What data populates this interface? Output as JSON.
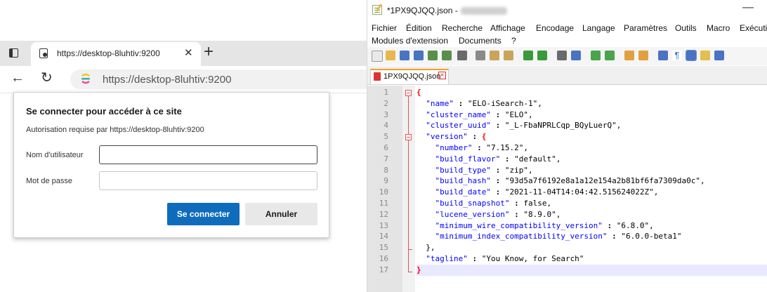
{
  "browser": {
    "tab_title": "https://desktop-8luhtiv:9200",
    "tab_close": "✕",
    "new_tab": "+",
    "url": "https://desktop-8luhtiv:9200",
    "dialog": {
      "title": "Se connecter pour accéder à ce site",
      "subtitle": "Autorisation requise par https://desktop-8luhtiv:9200",
      "username_label": "Nom d'utilisateur",
      "username_value": "",
      "password_label": "Mot de passe",
      "password_value": "",
      "signin_label": "Se connecter",
      "cancel_label": "Annuler"
    }
  },
  "npp": {
    "window_title": "*1PX9QJQQ.json -",
    "minimize": "—",
    "menu": [
      {
        "label": "Fichier"
      },
      {
        "label": "Édition"
      },
      {
        "label": "Recherche"
      },
      {
        "label": "Affichage"
      },
      {
        "label": "Encodage"
      },
      {
        "label": "Langage"
      },
      {
        "label": "Paramètres"
      },
      {
        "label": "Outils"
      },
      {
        "label": "Macro"
      },
      {
        "label": "Exécuti"
      },
      {
        "label": "Modules d'extension"
      },
      {
        "label": "Documents"
      },
      {
        "label": "?"
      }
    ],
    "file_tab": "1PX9QJQQ.json",
    "file_tab_close": "×",
    "line_numbers": [
      "1",
      "2",
      "3",
      "4",
      "5",
      "6",
      "7",
      "8",
      "9",
      "10",
      "11",
      "12",
      "13",
      "14",
      "15",
      "16",
      "17"
    ],
    "code": [
      {
        "indent": "",
        "key": "",
        "sep": "",
        "value": "",
        "brace": "{"
      },
      {
        "indent": "  ",
        "key": "\"name\"",
        "sep": " : ",
        "value": "\"ELO-iSearch-1\",",
        "brace": ""
      },
      {
        "indent": "  ",
        "key": "\"cluster_name\"",
        "sep": " : ",
        "value": "\"ELO\",",
        "brace": ""
      },
      {
        "indent": "  ",
        "key": "\"cluster_uuid\"",
        "sep": " : ",
        "value": "\"_L-FbaNPRLCqp_BQyLuerQ\",",
        "brace": ""
      },
      {
        "indent": "  ",
        "key": "\"version\"",
        "sep": " : ",
        "value": "",
        "brace": "{"
      },
      {
        "indent": "    ",
        "key": "\"number\"",
        "sep": " : ",
        "value": "\"7.15.2\",",
        "brace": ""
      },
      {
        "indent": "    ",
        "key": "\"build_flavor\"",
        "sep": " : ",
        "value": "\"default\",",
        "brace": ""
      },
      {
        "indent": "    ",
        "key": "\"build_type\"",
        "sep": " : ",
        "value": "\"zip\",",
        "brace": ""
      },
      {
        "indent": "    ",
        "key": "\"build_hash\"",
        "sep": " : ",
        "value": "\"93d5a7f6192e8a1a12e154a2b81bf6fa7309da0c\",",
        "brace": ""
      },
      {
        "indent": "    ",
        "key": "\"build_date\"",
        "sep": " : ",
        "value": "\"2021-11-04T14:04:42.515624022Z\",",
        "brace": ""
      },
      {
        "indent": "    ",
        "key": "\"build_snapshot\"",
        "sep": " : ",
        "value": "false,",
        "brace": ""
      },
      {
        "indent": "    ",
        "key": "\"lucene_version\"",
        "sep": " : ",
        "value": "\"8.9.0\",",
        "brace": ""
      },
      {
        "indent": "    ",
        "key": "\"minimum_wire_compatibility_version\"",
        "sep": " : ",
        "value": "\"6.8.0\",",
        "brace": ""
      },
      {
        "indent": "    ",
        "key": "\"minimum_index_compatibility_version\"",
        "sep": " : ",
        "value": "\"6.0.0-beta1\"",
        "brace": ""
      },
      {
        "indent": "  ",
        "key": "",
        "sep": "",
        "value": "},",
        "brace": ""
      },
      {
        "indent": "  ",
        "key": "\"tagline\"",
        "sep": " : ",
        "value": "\"You Know, for Search\"",
        "brace": ""
      },
      {
        "indent": "",
        "key": "",
        "sep": "",
        "value": "",
        "brace": "}"
      }
    ],
    "colors": {
      "key": "#0000ff",
      "brace": "#ff0000",
      "tab_accent": "#f3a128",
      "current_line": "#e8e8ff"
    }
  }
}
